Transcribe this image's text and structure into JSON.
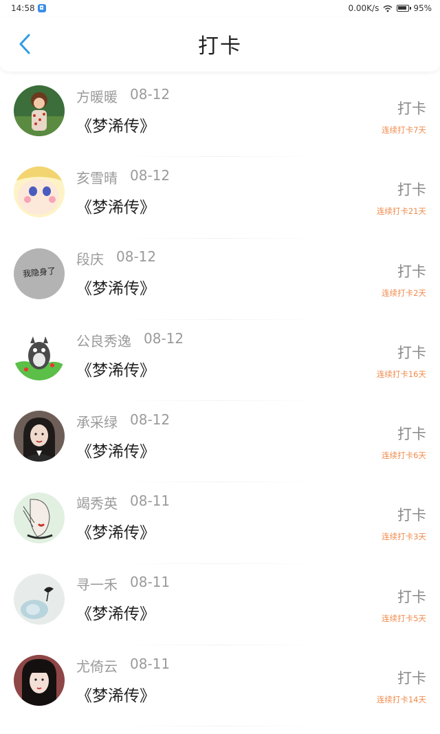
{
  "status_bar": {
    "time": "14:58",
    "network_speed": "0.00K/s",
    "battery": "95%",
    "battery_level": 0.95
  },
  "header": {
    "title": "打卡",
    "back_icon": "chevron-left-icon",
    "accent_color": "#2e9be6"
  },
  "entries": [
    {
      "name": "方暖暖",
      "date": "08-12",
      "book": "《梦浠传》",
      "action": "打卡",
      "streak": "连续打卡7天",
      "avatar_text": ""
    },
    {
      "name": "亥雪晴",
      "date": "08-12",
      "book": "《梦浠传》",
      "action": "打卡",
      "streak": "连续打卡21天",
      "avatar_text": ""
    },
    {
      "name": "段庆",
      "date": "08-12",
      "book": "《梦浠传》",
      "action": "打卡",
      "streak": "连续打卡2天",
      "avatar_text": "我隐身了"
    },
    {
      "name": "公良秀逸",
      "date": "08-12",
      "book": "《梦浠传》",
      "action": "打卡",
      "streak": "连续打卡16天",
      "avatar_text": ""
    },
    {
      "name": "承采绿",
      "date": "08-12",
      "book": "《梦浠传》",
      "action": "打卡",
      "streak": "连续打卡6天",
      "avatar_text": ""
    },
    {
      "name": "竭秀英",
      "date": "08-11",
      "book": "《梦浠传》",
      "action": "打卡",
      "streak": "连续打卡3天",
      "avatar_text": ""
    },
    {
      "name": "寻一禾",
      "date": "08-11",
      "book": "《梦浠传》",
      "action": "打卡",
      "streak": "连续打卡5天",
      "avatar_text": ""
    },
    {
      "name": "尤倚云",
      "date": "08-11",
      "book": "《梦浠传》",
      "action": "打卡",
      "streak": "连续打卡14天",
      "avatar_text": ""
    }
  ],
  "colors": {
    "streak": "#f08a4b",
    "name": "#9a9a9a"
  }
}
